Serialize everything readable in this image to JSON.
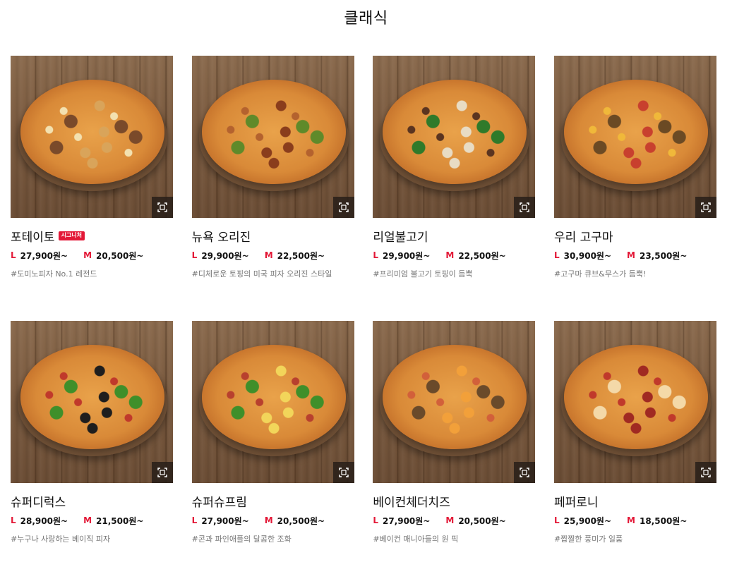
{
  "section": {
    "title": "클래식"
  },
  "colors": {
    "accent": "#e31837",
    "text": "#111111",
    "muted": "#777777"
  },
  "icons": {
    "zoom": "expand-frame-icon"
  },
  "products": [
    {
      "name": "포테이토",
      "badge": "시그니처",
      "size_l": "L",
      "price_l": "27,900원~",
      "size_m": "M",
      "price_m": "20,500원~",
      "desc": "#도미노피자 No.1 레전드",
      "image_alt": "potato pizza",
      "topping_colors": [
        "#f3e1b0",
        "#d9a45a",
        "#7a4a2a"
      ]
    },
    {
      "name": "뉴욕 오리진",
      "badge": "",
      "size_l": "L",
      "price_l": "29,900원~",
      "size_m": "M",
      "price_m": "22,500원~",
      "desc": "#디체로운 토핑의 미국 피자 오리진 스타일",
      "image_alt": "new york origin pizza",
      "topping_colors": [
        "#b4622e",
        "#8a3d1c",
        "#5f8a2a"
      ]
    },
    {
      "name": "리얼불고기",
      "badge": "",
      "size_l": "L",
      "price_l": "29,900원~",
      "size_m": "M",
      "price_m": "22,500원~",
      "desc": "#프리미엄 불고기 토핑이 듬뿍",
      "image_alt": "real bulgogi pizza",
      "topping_colors": [
        "#5a3420",
        "#e8dcc4",
        "#2f7a2a"
      ]
    },
    {
      "name": "우리 고구마",
      "badge": "",
      "size_l": "L",
      "price_l": "30,900원~",
      "size_m": "M",
      "price_m": "23,500원~",
      "desc": "#고구마 큐브&무스가 듬뿍!",
      "image_alt": "sweet potato pizza",
      "topping_colors": [
        "#f0b83a",
        "#c8402e",
        "#6b4a24"
      ]
    },
    {
      "name": "슈퍼디럭스",
      "badge": "",
      "size_l": "L",
      "price_l": "28,900원~",
      "size_m": "M",
      "price_m": "21,500원~",
      "desc": "#누구나 사랑하는 베이직 피자",
      "image_alt": "super deluxe pizza",
      "topping_colors": [
        "#c0392b",
        "#1e1e1e",
        "#3f8f2a"
      ]
    },
    {
      "name": "슈퍼슈프림",
      "badge": "",
      "size_l": "L",
      "price_l": "27,900원~",
      "size_m": "M",
      "price_m": "20,500원~",
      "desc": "#콘과 파인애플의 달콤한 조화",
      "image_alt": "super supreme pizza",
      "topping_colors": [
        "#b8402e",
        "#f2d55a",
        "#3f8f2a"
      ]
    },
    {
      "name": "베이컨체더치즈",
      "badge": "",
      "size_l": "L",
      "price_l": "27,900원~",
      "size_m": "M",
      "price_m": "20,500원~",
      "desc": "#베이컨 매니아들의 원 픽",
      "image_alt": "bacon cheddar cheese pizza",
      "topping_colors": [
        "#d2603a",
        "#f2a03a",
        "#6a4a2a"
      ]
    },
    {
      "name": "페퍼로니",
      "badge": "",
      "size_l": "L",
      "price_l": "25,900원~",
      "size_m": "M",
      "price_m": "18,500원~",
      "desc": "#짭짤한 풍미가 일품",
      "image_alt": "pepperoni pizza",
      "topping_colors": [
        "#c0392b",
        "#a02a22",
        "#f4d9a8"
      ]
    }
  ]
}
